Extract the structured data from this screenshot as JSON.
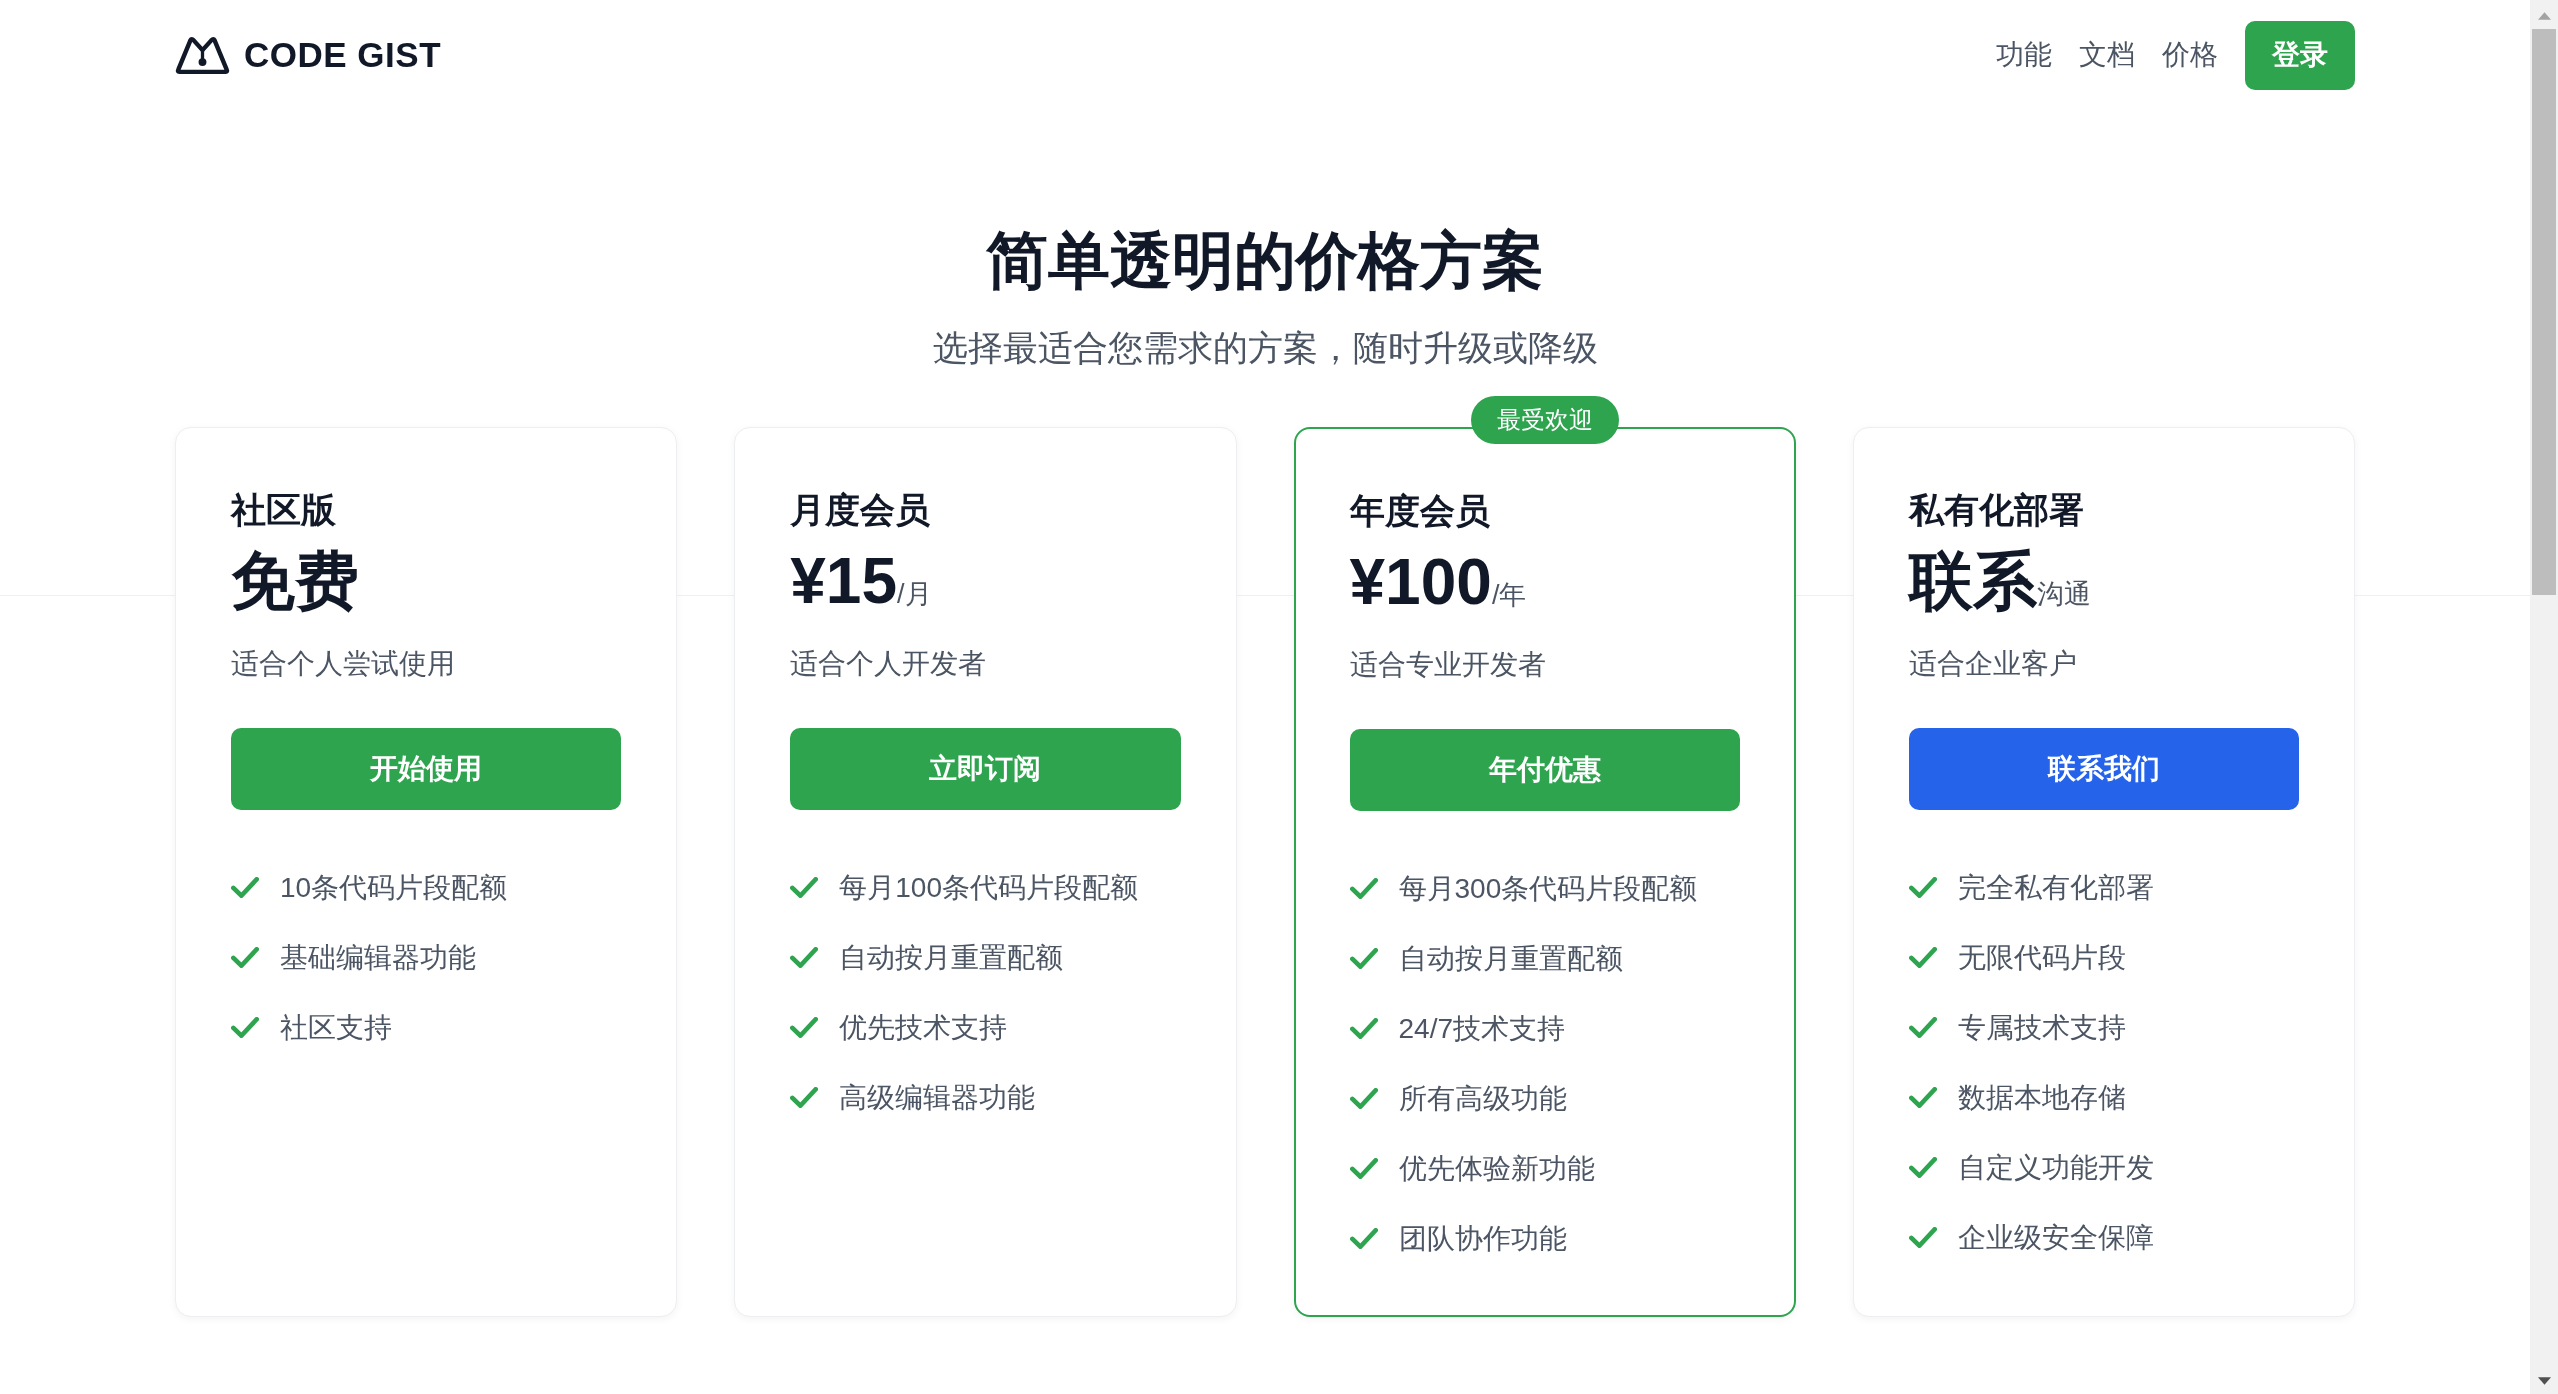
{
  "header": {
    "logo": "CODE GIST",
    "nav_links": [
      "功能",
      "文档",
      "价格"
    ],
    "login_button": "登录"
  },
  "hero": {
    "title": "简单透明的价格方案",
    "subtitle": "选择最适合您需求的方案，随时升级或降级"
  },
  "plans": [
    {
      "name": "社区版",
      "price": "免费",
      "description": "适合个人尝试使用",
      "button": {
        "label": "开始使用",
        "color": "#2ea44f"
      },
      "highlighted": false,
      "features": [
        "10条代码片段配额",
        "基础编辑器功能",
        "社区支持"
      ]
    },
    {
      "name": "月度会员",
      "price": "¥15",
      "unit": "/月",
      "description": "适合个人开发者",
      "button": {
        "label": "立即订阅",
        "color": "#2ea44f"
      },
      "highlighted": false,
      "features": [
        "每月100条代码片段配额",
        "自动按月重置配额",
        "优先技术支持",
        "高级编辑器功能"
      ]
    },
    {
      "badge": "最受欢迎",
      "name": "年度会员",
      "price": "¥100",
      "unit": "/年",
      "description": "适合专业开发者",
      "button": {
        "label": "年付优惠",
        "color": "#2ea44f"
      },
      "highlighted": true,
      "features": [
        "每月300条代码片段配额",
        "自动按月重置配额",
        "24/7技术支持",
        "所有高级功能",
        "优先体验新功能",
        "团队协作功能"
      ]
    },
    {
      "name": "私有化部署",
      "price": "联系",
      "unit": "沟通",
      "description": "适合企业客户",
      "button": {
        "label": "联系我们",
        "color": "#2563eb"
      },
      "highlighted": false,
      "features": [
        "完全私有化部署",
        "无限代码片段",
        "专属技术支持",
        "数据本地存储",
        "自定义功能开发",
        "企业级安全保障"
      ]
    }
  ]
}
